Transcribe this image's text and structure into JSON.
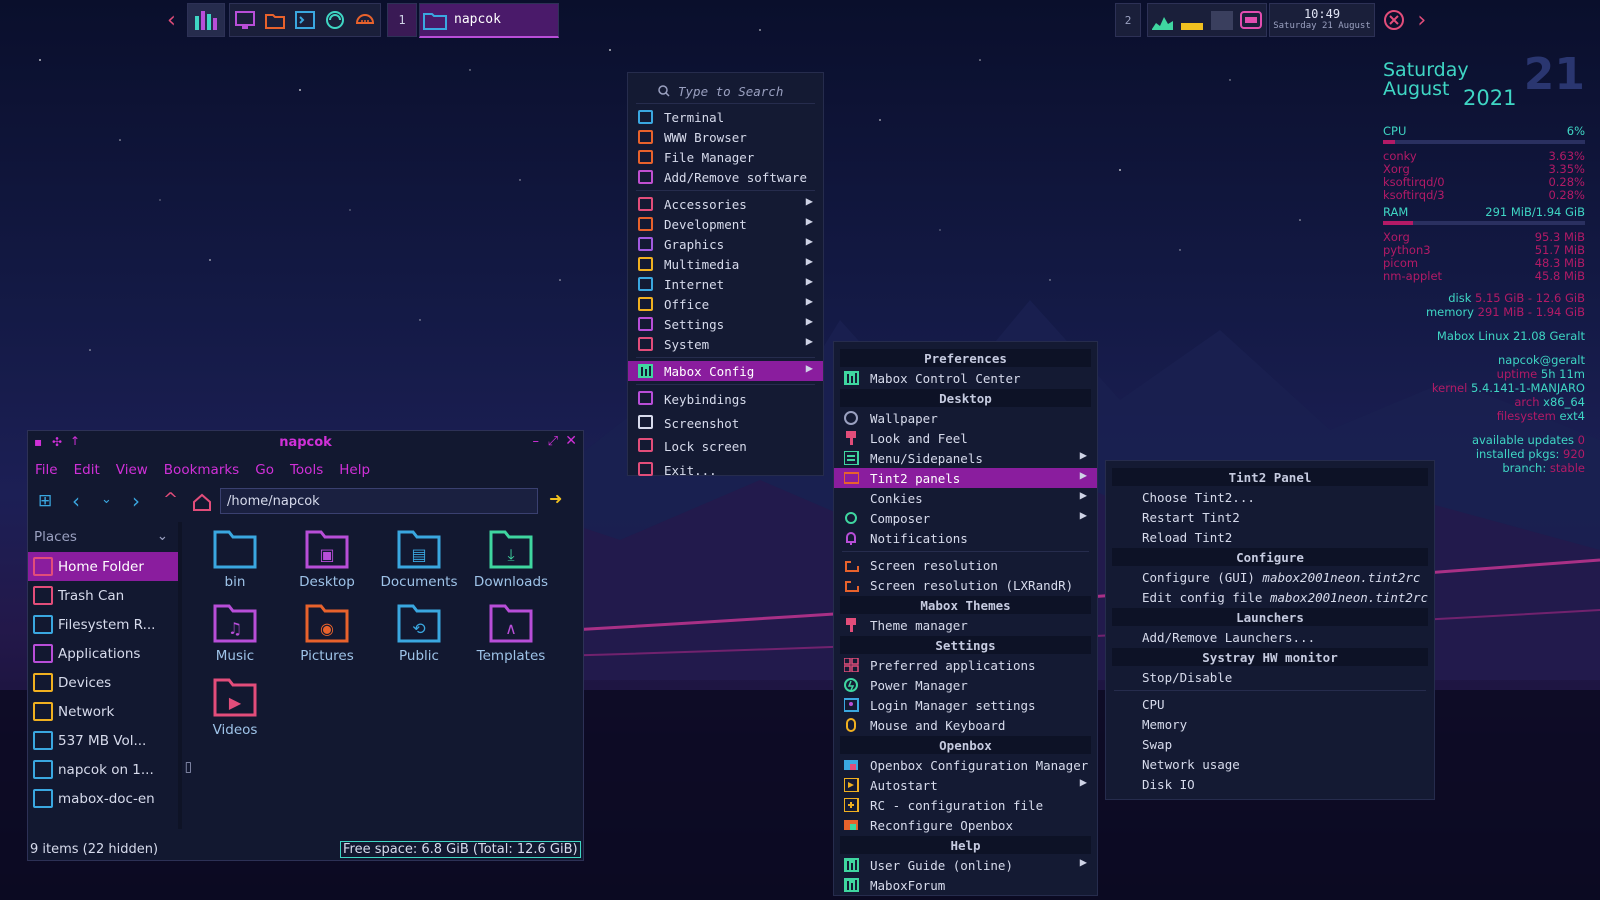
{
  "top_panel": {
    "workspace_1": "1",
    "active_window": "napcok",
    "workspace_2": "2",
    "clock_time": "10:49",
    "clock_date": "Saturday 21 August"
  },
  "conky": {
    "day_name": "Saturday",
    "month": "August",
    "day_num": "21",
    "year": "2021",
    "cpu_label": "CPU",
    "cpu_value": "6%",
    "cpu_level": 0.06,
    "cpu_procs": [
      {
        "name": "conky",
        "value": "3.63%"
      },
      {
        "name": "Xorg",
        "value": "3.35%"
      },
      {
        "name": "ksoftirqd/0",
        "value": "0.28%"
      },
      {
        "name": "ksoftirqd/3",
        "value": "0.28%"
      }
    ],
    "ram_label": "RAM",
    "ram_value": "291 MiB/1.94 GiB",
    "ram_level": 0.15,
    "ram_procs": [
      {
        "name": "Xorg",
        "value": "95.3 MiB"
      },
      {
        "name": "python3",
        "value": "51.7 MiB"
      },
      {
        "name": "picom",
        "value": "48.3 MiB"
      },
      {
        "name": "nm-applet",
        "value": "45.8 MiB"
      }
    ],
    "disk_label": "disk",
    "disk_value": "5.15 GiB - 12.6 GiB",
    "memory_label": "memory",
    "memory_value": "291 MiB - 1.94 GiB",
    "distro": "Mabox Linux 21.08 Geralt",
    "user": "napcok@geralt",
    "uptime_label": "uptime",
    "uptime_value": "5h 11m",
    "kernel_label": "kernel",
    "kernel_value": "5.4.141-1-MANJARO",
    "arch_label": "arch",
    "arch_value": "x86_64",
    "fs_label": "filesystem",
    "fs_value": "ext4",
    "updates_label": "available updates",
    "updates_value": "0",
    "pkgs_label": "installed pkgs:",
    "pkgs_value": "920",
    "branch_label": "branch:",
    "branch_value": "stable"
  },
  "main_menu": {
    "search_placeholder": "Type to Search",
    "items": [
      {
        "label": "Terminal",
        "icon": "terminal-icon",
        "color": "#3aa7e0"
      },
      {
        "label": "WWW Browser",
        "icon": "browser-icon",
        "color": "#e8622c"
      },
      {
        "label": "File Manager",
        "icon": "folder-icon",
        "color": "#e8622c"
      },
      {
        "label": "Add/Remove software",
        "icon": "package-icon",
        "color": "#c04fd0"
      }
    ],
    "categories": [
      {
        "label": "Accessories",
        "icon": "accessories-icon",
        "color": "#e24d7a"
      },
      {
        "label": "Development",
        "icon": "development-icon",
        "color": "#e8622c"
      },
      {
        "label": "Graphics",
        "icon": "graphics-icon",
        "color": "#a25ae0"
      },
      {
        "label": "Multimedia",
        "icon": "multimedia-icon",
        "color": "#f0b020"
      },
      {
        "label": "Internet",
        "icon": "internet-icon",
        "color": "#3aa7e0"
      },
      {
        "label": "Office",
        "icon": "office-icon",
        "color": "#f0b020"
      },
      {
        "label": "Settings",
        "icon": "settings-icon",
        "color": "#b84ed8"
      },
      {
        "label": "System",
        "icon": "system-icon",
        "color": "#e24d7a"
      }
    ],
    "mabox_config": "Mabox Config",
    "bottom": [
      {
        "label": "Keybindings",
        "icon": "keyboard-icon",
        "color": "#b84ed8"
      },
      {
        "label": "Screenshot",
        "icon": "screenshot-icon",
        "color": "#d7dbec"
      },
      {
        "label": "Lock screen",
        "icon": "lock-icon",
        "color": "#e24d7a"
      },
      {
        "label": "Exit...",
        "icon": "power-icon",
        "color": "#e24d7a"
      }
    ]
  },
  "config_menu": {
    "h_preferences": "Preferences",
    "control_center": "Mabox Control Center",
    "h_desktop": "Desktop",
    "wallpaper": "Wallpaper",
    "look_feel": "Look and Feel",
    "menu_sidepanels": "Menu/Sidepanels",
    "tint2_panels": "Tint2 panels",
    "conkies": "Conkies",
    "composer": "Composer",
    "notifications": "Notifications",
    "screen_resolution": "Screen resolution",
    "screen_resolution_lxrandr": "Screen resolution (LXRandR)",
    "h_themes": "Mabox Themes",
    "theme_manager": "Theme manager",
    "h_settings": "Settings",
    "preferred_apps": "Preferred applications",
    "power_manager": "Power Manager",
    "login_manager": "Login Manager settings",
    "mouse_keyboard": "Mouse and Keyboard",
    "h_openbox": "Openbox",
    "ob_config": "Openbox Configuration Manager",
    "autostart": "Autostart",
    "rc_file": "RC - configuration file",
    "reconfigure": "Reconfigure Openbox",
    "h_help": "Help",
    "user_guide": "User Guide (online)",
    "forum": "MaboxForum"
  },
  "tint2_menu": {
    "h_panel": "Tint2 Panel",
    "choose": "Choose Tint2...",
    "restart": "Restart Tint2",
    "reload": "Reload Tint2",
    "h_configure": "Configure",
    "configure_gui": "Configure (GUI)",
    "config_file_name": "mabox2001neon.tint2rc",
    "edit_config": "Edit config file",
    "h_launchers": "Launchers",
    "add_remove_launchers": "Add/Remove Launchers...",
    "h_systray": "Systray HW monitor",
    "stop_disable": "Stop/Disable",
    "cpu": "CPU",
    "memory": "Memory",
    "swap": "Swap",
    "network": "Network usage",
    "disk_io": "Disk IO"
  },
  "file_manager": {
    "title": "napcok",
    "menus": [
      "File",
      "Edit",
      "View",
      "Bookmarks",
      "Go",
      "Tools",
      "Help"
    ],
    "path": "/home/napcok",
    "places_label": "Places",
    "places": [
      {
        "label": "Home Folder",
        "icon": "home-icon",
        "color": "#e24d7a"
      },
      {
        "label": "Trash Can",
        "icon": "trash-icon",
        "color": "#e24d7a"
      },
      {
        "label": "Filesystem R...",
        "icon": "folder-icon",
        "color": "#3aa7e0"
      },
      {
        "label": "Applications",
        "icon": "applications-icon",
        "color": "#b84ed8"
      },
      {
        "label": "Devices",
        "icon": "devices-icon",
        "color": "#f0b020"
      },
      {
        "label": "Network",
        "icon": "network-icon",
        "color": "#f0b020"
      },
      {
        "label": "537 MB Vol...",
        "icon": "drive-icon",
        "color": "#3aa7e0"
      },
      {
        "label": "napcok on 1...",
        "icon": "folder-icon",
        "color": "#3aa7e0"
      },
      {
        "label": "mabox-doc-en",
        "icon": "folder-icon",
        "color": "#3aa7e0"
      }
    ],
    "files": [
      {
        "label": "bin",
        "color": "#3aa7e0",
        "glyph": ""
      },
      {
        "label": "Desktop",
        "color": "#b84ed8",
        "glyph": "▣"
      },
      {
        "label": "Documents",
        "color": "#3aa7e0",
        "glyph": "▤"
      },
      {
        "label": "Downloads",
        "color": "#3fd6a0",
        "glyph": "⤓"
      },
      {
        "label": "Music",
        "color": "#b84ed8",
        "glyph": "♫"
      },
      {
        "label": "Pictures",
        "color": "#e8622c",
        "glyph": "◉"
      },
      {
        "label": "Public",
        "color": "#3aa7e0",
        "glyph": "⟲"
      },
      {
        "label": "Templates",
        "color": "#b84ed8",
        "glyph": "∧"
      },
      {
        "label": "Videos",
        "color": "#e24d7a",
        "glyph": "▶"
      }
    ],
    "status_items": "9 items (22 hidden)",
    "status_free": "Free space: 6.8 GiB (Total: 12.6 GiB)"
  }
}
